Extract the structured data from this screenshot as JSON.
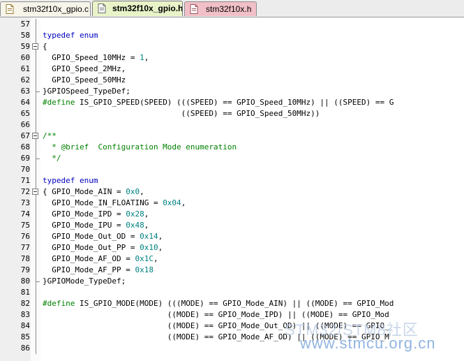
{
  "tabs": [
    {
      "label": "stm32f10x_gpio.c",
      "icon": "c-file-icon",
      "active": false
    },
    {
      "label": "stm32f10x_gpio.h",
      "icon": "h-file-icon",
      "active": true
    },
    {
      "label": "stm32f10x.h",
      "icon": "h-file-icon",
      "active": false
    }
  ],
  "colors": {
    "keyword": "#0000c0",
    "number": "#008080",
    "comment": "#008000",
    "active_tab": "#e8f3c8",
    "third_tab": "#f1bfc7"
  },
  "editor": {
    "lines": [
      {
        "n": "57",
        "spans": [],
        "fold": "line"
      },
      {
        "n": "58",
        "spans": [
          {
            "t": "typedef enum",
            "c": "kw"
          }
        ],
        "fold": "line"
      },
      {
        "n": "59",
        "spans": [
          {
            "t": "{",
            "c": ""
          }
        ],
        "fold": "box"
      },
      {
        "n": "60",
        "spans": [
          {
            "t": "  GPIO_Speed_10MHz = ",
            "c": ""
          },
          {
            "t": "1",
            "c": "num"
          },
          {
            "t": ",",
            "c": ""
          }
        ],
        "fold": "line"
      },
      {
        "n": "61",
        "spans": [
          {
            "t": "  GPIO_Speed_2MHz,",
            "c": ""
          }
        ],
        "fold": "line"
      },
      {
        "n": "62",
        "spans": [
          {
            "t": "  GPIO_Speed_50MHz",
            "c": ""
          }
        ],
        "fold": "line"
      },
      {
        "n": "63",
        "spans": [
          {
            "t": "}GPIOSpeed_TypeDef;",
            "c": ""
          }
        ],
        "fold": "end"
      },
      {
        "n": "64",
        "spans": [
          {
            "t": "#define",
            "c": "cm"
          },
          {
            "t": " IS_GPIO_SPEED(SPEED) (((SPEED) == GPIO_Speed_10MHz) || ((SPEED) == G",
            "c": ""
          }
        ],
        "fold": "line"
      },
      {
        "n": "65",
        "spans": [
          {
            "t": "                              ((SPEED) == GPIO_Speed_50MHz))",
            "c": ""
          }
        ],
        "fold": "line"
      },
      {
        "n": "66",
        "spans": [],
        "fold": "line"
      },
      {
        "n": "67",
        "spans": [
          {
            "t": "/**",
            "c": "cm"
          }
        ],
        "fold": "box"
      },
      {
        "n": "68",
        "spans": [
          {
            "t": "  * @brief  Configuration Mode enumeration",
            "c": "cm"
          }
        ],
        "fold": "line"
      },
      {
        "n": "69",
        "spans": [
          {
            "t": "  */",
            "c": "cm"
          }
        ],
        "fold": "end"
      },
      {
        "n": "70",
        "spans": [],
        "fold": "line"
      },
      {
        "n": "71",
        "spans": [
          {
            "t": "typedef enum",
            "c": "kw"
          }
        ],
        "fold": "line"
      },
      {
        "n": "72",
        "spans": [
          {
            "t": "{ GPIO_Mode_AIN = ",
            "c": ""
          },
          {
            "t": "0x0",
            "c": "num"
          },
          {
            "t": ",",
            "c": ""
          }
        ],
        "fold": "box"
      },
      {
        "n": "73",
        "spans": [
          {
            "t": "  GPIO_Mode_IN_FLOATING = ",
            "c": ""
          },
          {
            "t": "0x04",
            "c": "num"
          },
          {
            "t": ",",
            "c": ""
          }
        ],
        "fold": "line"
      },
      {
        "n": "74",
        "spans": [
          {
            "t": "  GPIO_Mode_IPD = ",
            "c": ""
          },
          {
            "t": "0x28",
            "c": "num"
          },
          {
            "t": ",",
            "c": ""
          }
        ],
        "fold": "line"
      },
      {
        "n": "75",
        "spans": [
          {
            "t": "  GPIO_Mode_IPU = ",
            "c": ""
          },
          {
            "t": "0x48",
            "c": "num"
          },
          {
            "t": ",",
            "c": ""
          }
        ],
        "fold": "line"
      },
      {
        "n": "76",
        "spans": [
          {
            "t": "  GPIO_Mode_Out_OD = ",
            "c": ""
          },
          {
            "t": "0x14",
            "c": "num"
          },
          {
            "t": ",",
            "c": ""
          }
        ],
        "fold": "line"
      },
      {
        "n": "77",
        "spans": [
          {
            "t": "  GPIO_Mode_Out_PP = ",
            "c": ""
          },
          {
            "t": "0x10",
            "c": "num"
          },
          {
            "t": ",",
            "c": ""
          }
        ],
        "fold": "line"
      },
      {
        "n": "78",
        "spans": [
          {
            "t": "  GPIO_Mode_AF_OD = ",
            "c": ""
          },
          {
            "t": "0x1C",
            "c": "num"
          },
          {
            "t": ",",
            "c": ""
          }
        ],
        "fold": "line"
      },
      {
        "n": "79",
        "spans": [
          {
            "t": "  GPIO_Mode_AF_PP = ",
            "c": ""
          },
          {
            "t": "0x18",
            "c": "num"
          }
        ],
        "fold": "line"
      },
      {
        "n": "80",
        "spans": [
          {
            "t": "}GPIOMode_TypeDef;",
            "c": ""
          }
        ],
        "fold": "end"
      },
      {
        "n": "81",
        "spans": [],
        "fold": "line"
      },
      {
        "n": "82",
        "spans": [
          {
            "t": "#define",
            "c": "cm"
          },
          {
            "t": " IS_GPIO_MODE(MODE) (((MODE) == GPIO_Mode_AIN) || ((MODE) == GPIO_Mod",
            "c": ""
          }
        ],
        "fold": "line"
      },
      {
        "n": "83",
        "spans": [
          {
            "t": "                           ((MODE) == GPIO_Mode_IPD) || ((MODE) == GPIO_Mod",
            "c": ""
          }
        ],
        "fold": "line"
      },
      {
        "n": "84",
        "spans": [
          {
            "t": "                           ((MODE) == GPIO_Mode_Out_OD) || ((MODE) == GPIO_",
            "c": ""
          }
        ],
        "fold": "line"
      },
      {
        "n": "85",
        "spans": [
          {
            "t": "                           ((MODE) == GPIO_Mode_AF_OD) || ((MODE) == GPIO_M",
            "c": ""
          }
        ],
        "fold": "line"
      },
      {
        "n": "86",
        "spans": [],
        "fold": "line"
      }
    ]
  },
  "watermark": {
    "line1": "STM32/STM8社区",
    "line2": "www.stmcu.org.cn"
  }
}
